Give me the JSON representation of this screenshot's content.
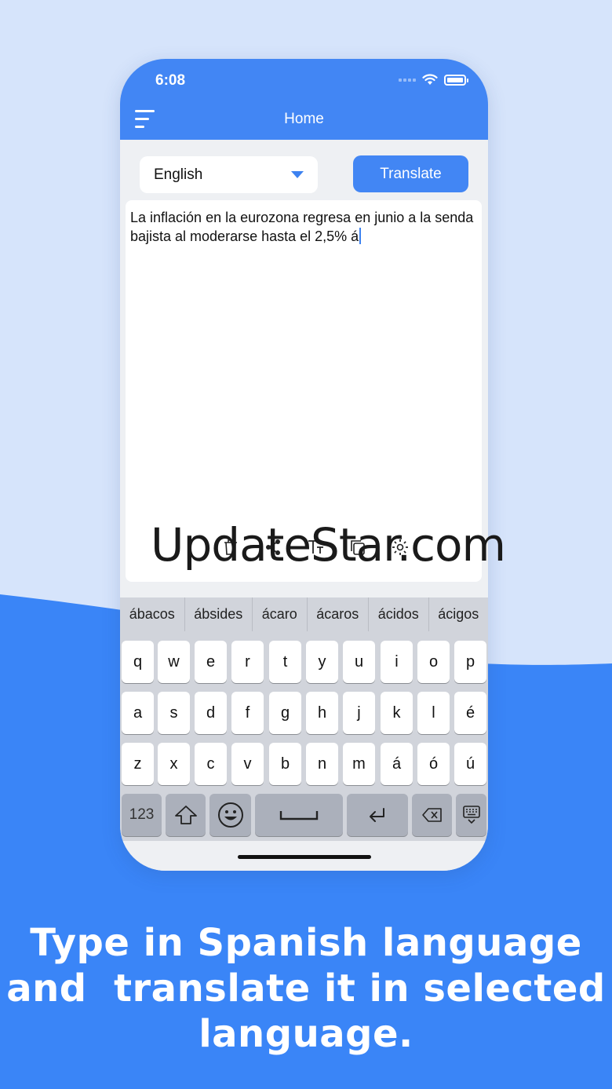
{
  "status_bar": {
    "time": "6:08"
  },
  "header": {
    "title": "Home",
    "menu_icon": "hamburger-menu-icon"
  },
  "language_select": {
    "selected": "English"
  },
  "translate_button": {
    "label": "Translate"
  },
  "text_input": {
    "value": "La inflación en la eurozona regresa en junio a la senda bajista al moderarse hasta el 2,5% á"
  },
  "text_tools": [
    "trash-icon",
    "share-icon",
    "text-format-icon",
    "copy-icon",
    "settings-gear-icon"
  ],
  "keyboard": {
    "suggestions": [
      "ábacos",
      "ábsides",
      "ácaro",
      "ácaros",
      "ácidos",
      "ácigos"
    ],
    "row1": [
      "q",
      "w",
      "e",
      "r",
      "t",
      "y",
      "u",
      "i",
      "o",
      "p"
    ],
    "row2": [
      "a",
      "s",
      "d",
      "f",
      "g",
      "h",
      "j",
      "k",
      "l",
      "é"
    ],
    "row3": [
      "z",
      "x",
      "c",
      "v",
      "b",
      "n",
      "m",
      "á",
      "ó",
      "ú"
    ],
    "numbers_key": "123",
    "special_icons": [
      "shift-icon",
      "emoji-icon",
      "space-icon",
      "return-icon",
      "backspace-icon",
      "keyboard-hide-icon"
    ]
  },
  "watermark": "UpdateStar.com",
  "caption": {
    "line1": "Type in Spanish language",
    "line2": "and  translate it in selected",
    "line3": "language."
  },
  "colors": {
    "accent": "#4286f4",
    "background": "#d6e4fb",
    "wave": "#3a85f7"
  }
}
